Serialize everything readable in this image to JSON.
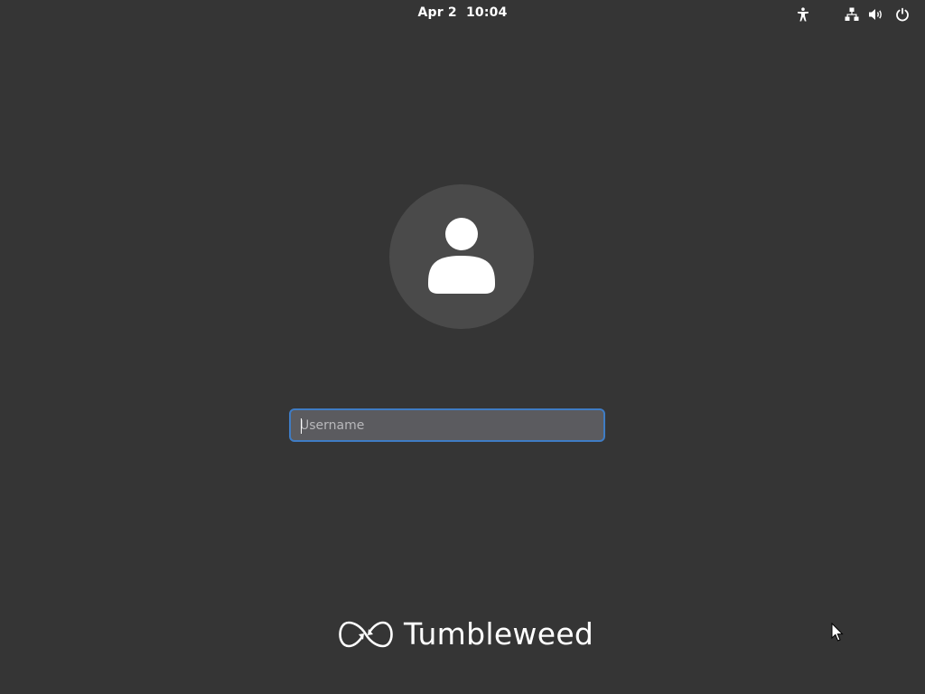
{
  "topbar": {
    "clock": "Apr 2  10:04",
    "tray": [
      {
        "name": "accessibility-icon"
      },
      {
        "name": "network-icon"
      },
      {
        "name": "volume-icon"
      },
      {
        "name": "power-icon"
      }
    ]
  },
  "login": {
    "avatar_icon": "user-icon",
    "username": {
      "value": "",
      "placeholder": "Username"
    }
  },
  "branding": {
    "logo_icon": "tumbleweed-logo-icon",
    "text": "Tumbleweed"
  },
  "colors": {
    "background": "#353535",
    "avatar_bg": "#4a4a4a",
    "input_bg": "#5b5b5f",
    "focus_border": "#3f7cc4",
    "foreground": "#ffffff"
  }
}
